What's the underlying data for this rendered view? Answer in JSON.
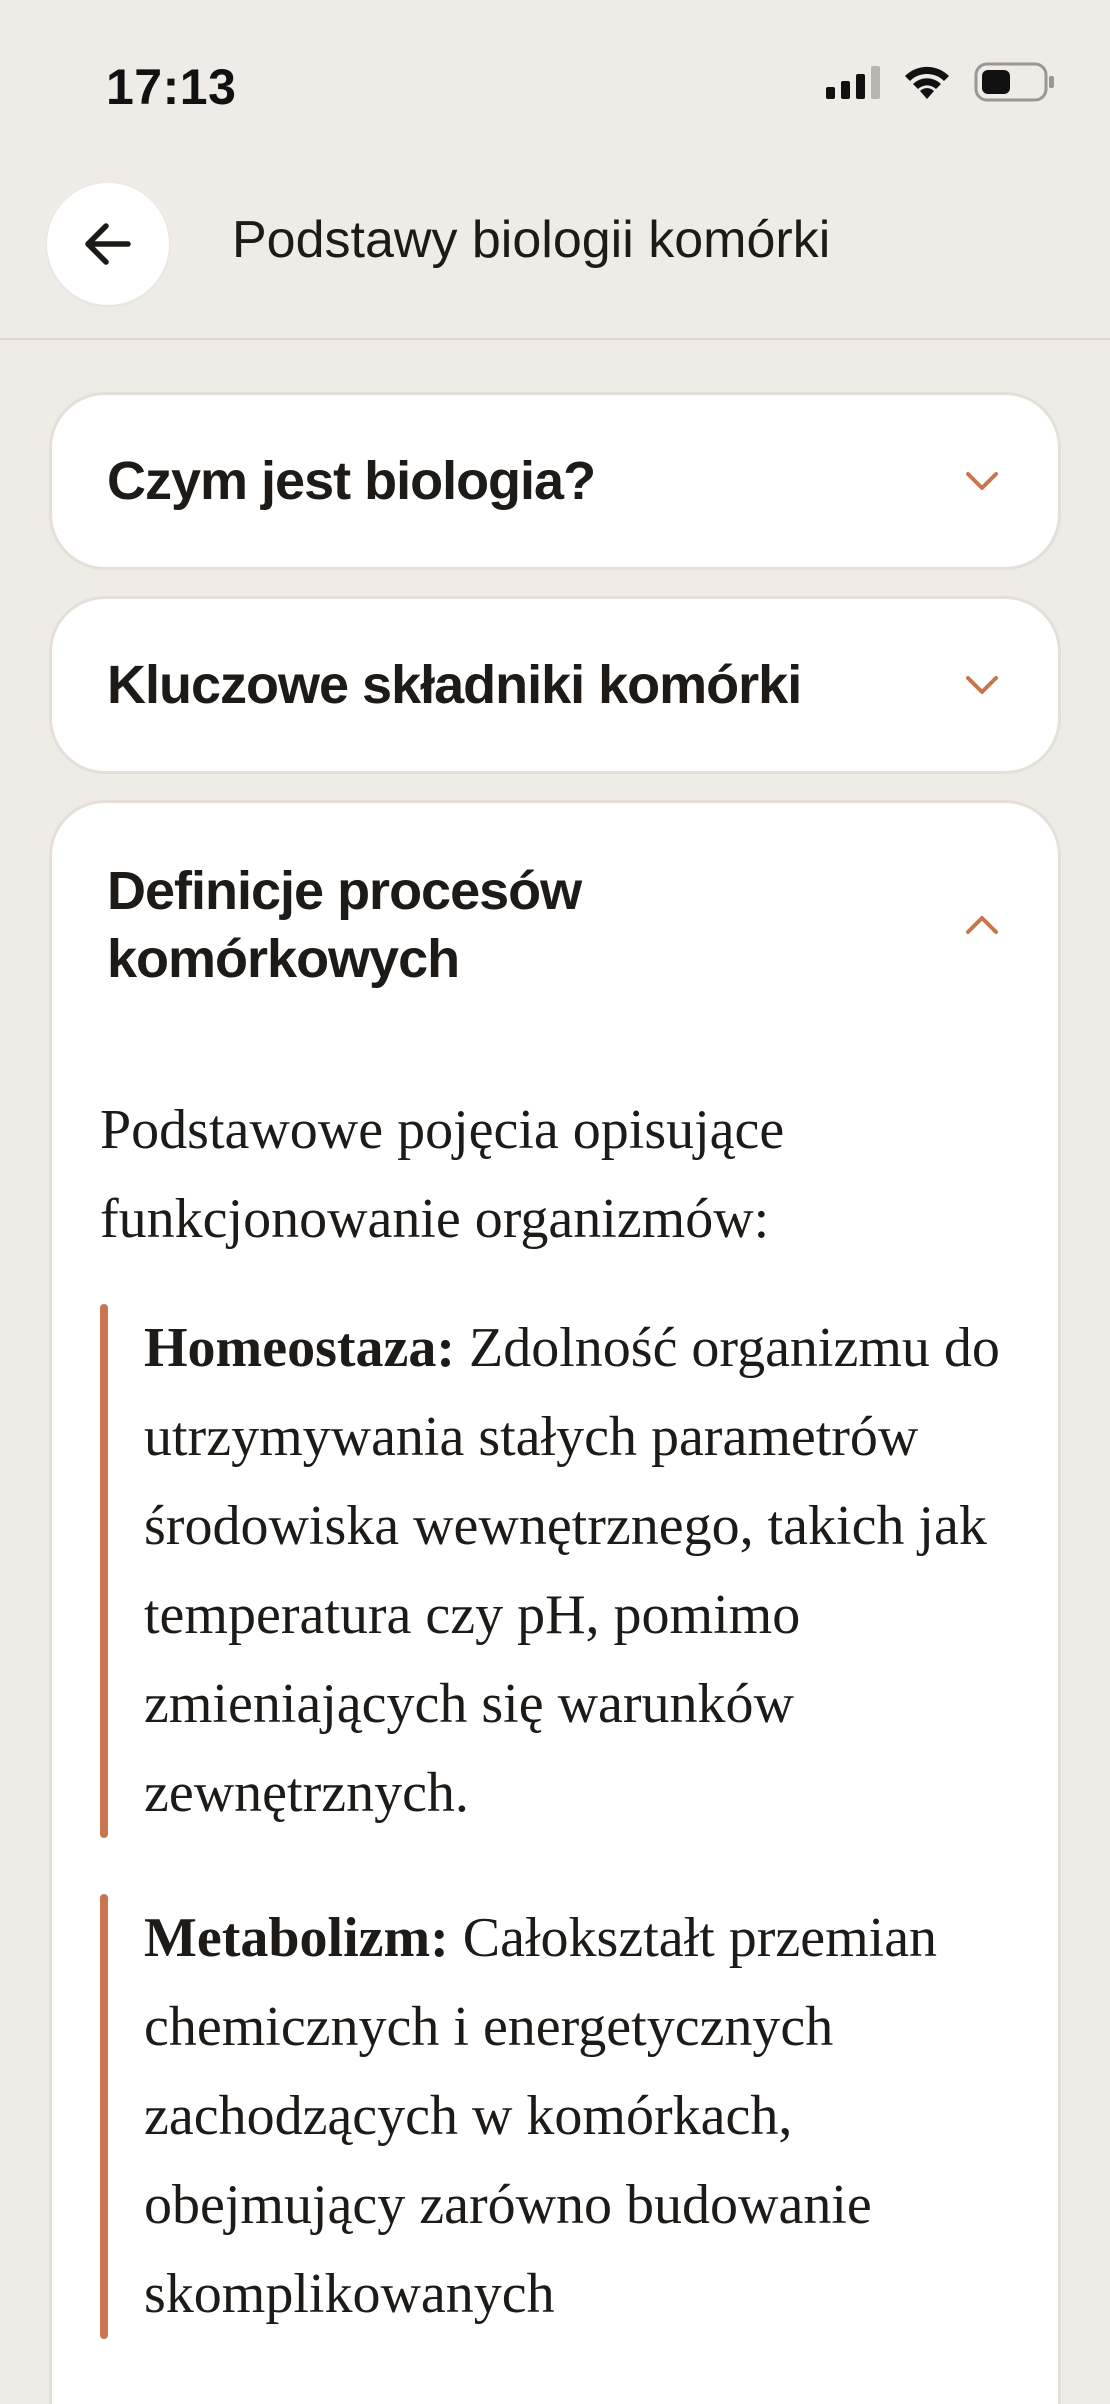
{
  "status_bar": {
    "time": "17:13",
    "icons": [
      "signal-icon",
      "wifi-icon",
      "battery-icon"
    ]
  },
  "header": {
    "back_icon": "arrow-left-icon",
    "title": "Podstawy biologii komórki"
  },
  "accordion": {
    "items": [
      {
        "title": "Czym jest biologia?",
        "expanded": false,
        "icon": "chevron-down-icon"
      },
      {
        "title": "Kluczowe składniki komórki",
        "expanded": false,
        "icon": "chevron-down-icon"
      },
      {
        "title_line1": "Definicje procesów",
        "title_line2": "komórkowych",
        "expanded": true,
        "icon": "chevron-up-icon",
        "intro": "Podstawowe pojęcia opisujące funkcjonowanie organizmów:",
        "definitions": [
          {
            "term": "Homeostaza:",
            "text": " Zdolność organizmu do utrzymywania stałych parametrów środowiska wewnętrznego, takich jak temperatura czy pH, pomimo zmieniających się warunków zewnętrznych."
          },
          {
            "term": "Metabolizm:",
            "text": " Całokształt przemian chemicznych i energetycznych zachodzących w komórkach, obejmujący zarówno budowanie skomplikowanych"
          }
        ]
      }
    ]
  },
  "colors": {
    "background": "#efebe6",
    "card": "#ffffff",
    "accent": "#c8764d",
    "text": "#1d1a17"
  }
}
